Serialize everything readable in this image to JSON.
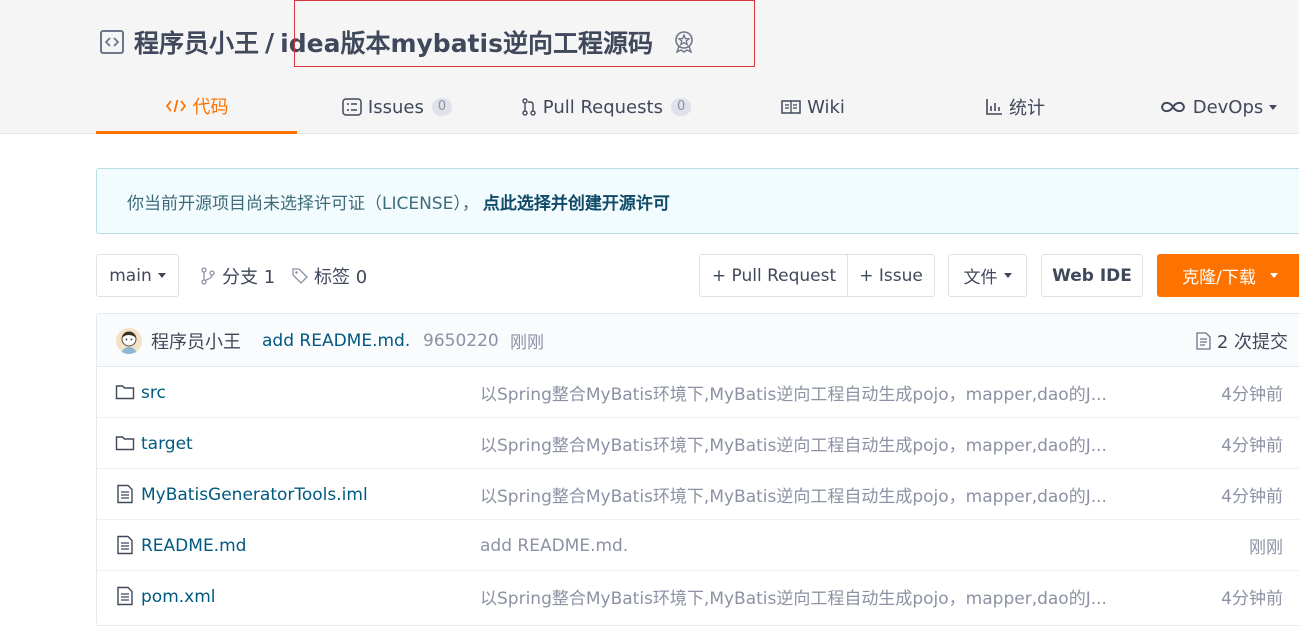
{
  "header": {
    "owner": "程序员小王",
    "separator": "/",
    "repo_name": "idea版本mybatis逆向工程源码"
  },
  "tabs": [
    {
      "label": "代码"
    },
    {
      "label": "Issues",
      "count": "0"
    },
    {
      "label": "Pull Requests",
      "count": "0"
    },
    {
      "label": "Wiki"
    },
    {
      "label": "统计"
    },
    {
      "label": "DevOps"
    }
  ],
  "notice": {
    "text": "你当前开源项目尚未选择许可证（LICENSE），",
    "link": "点此选择并创建开源许可"
  },
  "toolbar": {
    "branch": "main",
    "branches_label": "分支 1",
    "tags_label": "标签 0",
    "pull_request_button": "+ Pull Request",
    "issue_button": "+ Issue",
    "file_button": "文件",
    "webide_button": "Web IDE",
    "clone_button": "克隆/下载"
  },
  "commit": {
    "author": "程序员小王",
    "message": "add README.md.",
    "hash": "9650220",
    "time": "刚刚",
    "count_label": "2 次提交"
  },
  "files": [
    {
      "type": "folder",
      "name": "src",
      "message": "以Spring整合MyBatis环境下,MyBatis逆向工程自动生成pojo，mapper,dao的J...",
      "time": "4分钟前"
    },
    {
      "type": "folder",
      "name": "target",
      "message": "以Spring整合MyBatis环境下,MyBatis逆向工程自动生成pojo，mapper,dao的J...",
      "time": "4分钟前"
    },
    {
      "type": "file",
      "name": "MyBatisGeneratorTools.iml",
      "message": "以Spring整合MyBatis环境下,MyBatis逆向工程自动生成pojo，mapper,dao的J...",
      "time": "4分钟前"
    },
    {
      "type": "file",
      "name": "README.md",
      "message": "add README.md.",
      "time": "刚刚"
    },
    {
      "type": "file",
      "name": "pom.xml",
      "message": "以Spring整合MyBatis环境下,MyBatis逆向工程自动生成pojo，mapper,dao的J...",
      "time": "4分钟前"
    }
  ],
  "colors": {
    "accent": "#fe7300",
    "link": "#005980",
    "highlight_box": "#d9363e"
  }
}
